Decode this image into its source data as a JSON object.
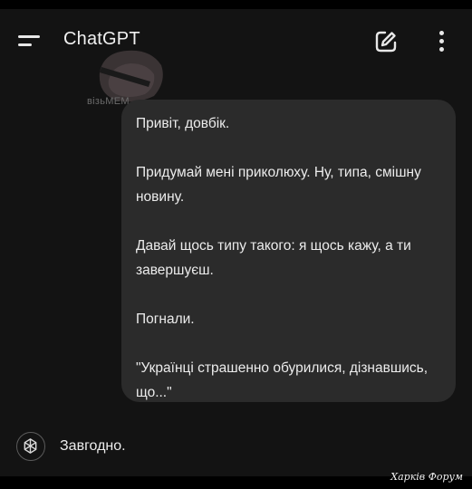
{
  "header": {
    "title": "ChatGPT",
    "menu_icon": "hamburger-menu-icon",
    "new_chat_icon": "edit-pencil-icon",
    "more_icon": "vertical-dots-icon"
  },
  "sticker": {
    "caption": "візьМЕМ"
  },
  "user_message": {
    "paragraphs": [
      "Привіт, довбік.",
      "Придумай мені приколюху. Ну, типа, смішну новину.",
      "Давай щось типу такого: я щось кажу, а ти завершуєш.",
      "Погнали.",
      "\"Українці страшенно обурилися, дізнавшись, що...\""
    ]
  },
  "assistant_message": {
    "icon": "openai-logo-icon",
    "text": "Завгодно."
  },
  "watermark": {
    "text": "Харків Форум"
  },
  "colors": {
    "background": "#131313",
    "bubble": "#2b2b2b",
    "text": "#ececec"
  }
}
